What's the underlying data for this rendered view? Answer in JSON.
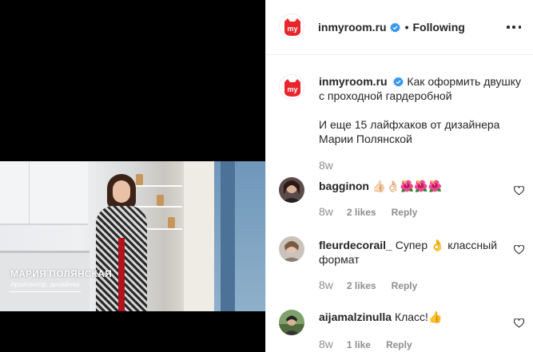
{
  "video": {
    "caption_name": "МАРИЯ ПОЛЯНСКАЯ",
    "caption_role": "Архитектор, дизайнер"
  },
  "header": {
    "username": "inmyroom.ru",
    "separator": "•",
    "follow_state": "Following",
    "logo_text": "my"
  },
  "caption": {
    "username": "inmyroom.ru",
    "line1": "Как оформить двушку с проходной гардеробной",
    "line2": "И еще 15 лайфхаков от дизайнера Марии Полянской",
    "time": "8w"
  },
  "comments": [
    {
      "username": "bagginon",
      "text": "👍🏻👌🏻🌺🌺🌺",
      "time": "8w",
      "likes": "2 likes",
      "reply": "Reply"
    },
    {
      "username": "fleurdecorail_",
      "text": "Супер 👌 классный формат",
      "time": "8w",
      "likes": "2 likes",
      "reply": "Reply"
    },
    {
      "username": "aijamalzinulla",
      "text": "Класс!👍",
      "time": "8w",
      "likes": "1 like",
      "reply": "Reply"
    }
  ],
  "colors": {
    "brand_red": "#e8262b",
    "verified_blue": "#3897f0",
    "muted_text": "#8e8e8e"
  },
  "icons": [
    "verified-badge-icon",
    "more-options-icon",
    "heart-icon"
  ]
}
